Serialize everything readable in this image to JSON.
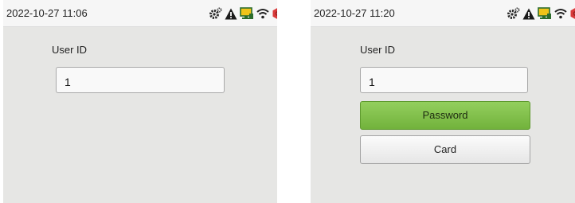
{
  "screens": [
    {
      "datetime": "2022-10-27 11:06",
      "user_id_label": "User ID",
      "user_id_value": "1"
    },
    {
      "datetime": "2022-10-27 11:20",
      "user_id_label": "User ID",
      "user_id_value": "1",
      "verify_options": [
        "Password",
        "Card"
      ]
    }
  ],
  "status_icons": [
    "settings-gear-icon",
    "warning-icon",
    "monitor-icon",
    "wifi-icon",
    "alert-badge-icon"
  ],
  "colors": {
    "screen_background": "#e6e6e4",
    "selected_option": "#7dbc45",
    "warning": "#1b1b1b",
    "monitor": "#f0c419",
    "alert_badge": "#d83a3a"
  }
}
